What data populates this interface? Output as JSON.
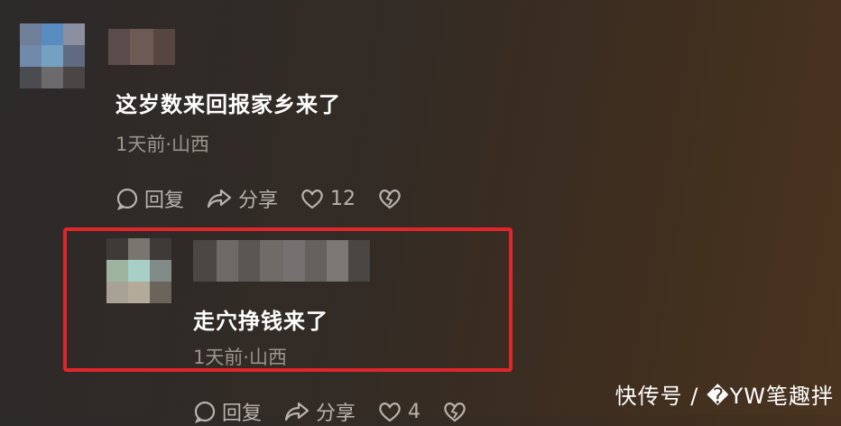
{
  "comments": [
    {
      "text": "这岁数来回报家乡来了",
      "meta": "1天前·山西",
      "actions": {
        "reply": "回复",
        "share": "分享",
        "likes": "12"
      }
    },
    {
      "text": "走穴挣钱来了",
      "meta": "1天前·山西",
      "actions": {
        "reply": "回复",
        "share": "分享",
        "likes": "4"
      }
    }
  ],
  "watermark": "快传号 / �YW笔趣拌",
  "colors": {
    "highlight": "#e0262b",
    "meta_text": "#9a948d",
    "action_text": "#b8b3ad"
  }
}
